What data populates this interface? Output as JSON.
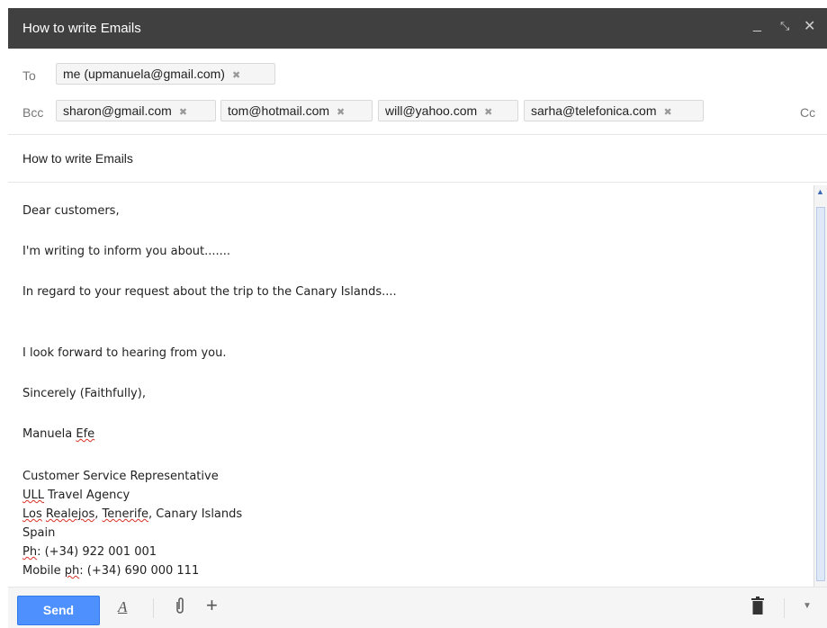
{
  "window": {
    "title": "How to write Emails"
  },
  "recipients": {
    "to_label": "To",
    "bcc_label": "Bcc",
    "cc_label": "Cc",
    "to": [
      "me (upmanuela@gmail.com)"
    ],
    "bcc": [
      "sharon@gmail.com",
      "tom@hotmail.com",
      "will@yahoo.com",
      "sarha@telefonica.com"
    ]
  },
  "subject": "How to write Emails",
  "body": {
    "greeting": "Dear customers,",
    "line1": "I'm writing to inform you about.......",
    "line2": "In regard to your request about the trip to the Canary Islands....",
    "closing1": "I look forward to hearing from you.",
    "closing2": "Sincerely (Faithfully),",
    "sig_first": "Manuela",
    "sig_last": "Efe",
    "title": "Customer Service Representative",
    "agency_abbr": "ULL",
    "agency_rest": "Travel Agency",
    "city1": "Los",
    "city2": "Realejos",
    "city3": "Tenerife",
    "city_rest": ", Canary Islands",
    "country": "Spain",
    "ph_label": "Ph",
    "ph_value": ": (+34) 922 001 001",
    "mobile_label": "Mobile",
    "mobile_ph": "ph",
    "mobile_value": ": (+34) 690 000 111"
  },
  "toolbar": {
    "send": "Send"
  }
}
